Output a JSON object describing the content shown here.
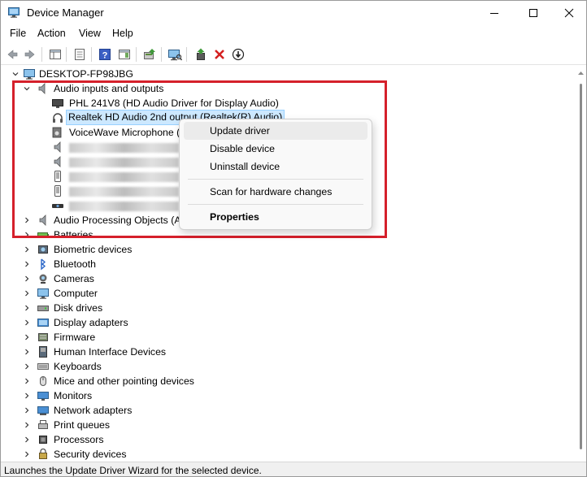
{
  "window": {
    "title": "Device Manager"
  },
  "menu": [
    "File",
    "Action",
    "View",
    "Help"
  ],
  "toolbar": [
    "back-icon",
    "forward-icon",
    "show-hide-tree-icon",
    "properties-icon",
    "help-icon",
    "action-pane-icon",
    "update-driver-icon",
    "scan-hardware-icon",
    "enable-device-icon",
    "uninstall-icon",
    "disable-device-icon"
  ],
  "tree": {
    "root": "DESKTOP-FP98JBG",
    "expanded_category": "Audio inputs and outputs",
    "audio_devices": [
      "PHL 241V8 (HD Audio Driver for Display Audio)",
      "Realtek HD Audio 2nd output (Realtek(R) Audio)",
      "VoiceWave Microphone (I"
    ],
    "categories": [
      "Audio Processing Objects (AP",
      "Batteries",
      "Biometric devices",
      "Bluetooth",
      "Cameras",
      "Computer",
      "Disk drives",
      "Display adapters",
      "Firmware",
      "Human Interface Devices",
      "Keyboards",
      "Mice and other pointing devices",
      "Monitors",
      "Network adapters",
      "Print queues",
      "Processors",
      "Security devices"
    ]
  },
  "context_menu": {
    "items": [
      "Update driver",
      "Disable device",
      "Uninstall device",
      "Scan for hardware changes",
      "Properties"
    ]
  },
  "status": "Launches the Update Driver Wizard for the selected device.",
  "colors": {
    "highlight": "#d5202b",
    "selection": "#cce8ff",
    "menu_hover": "#ebebeb"
  }
}
